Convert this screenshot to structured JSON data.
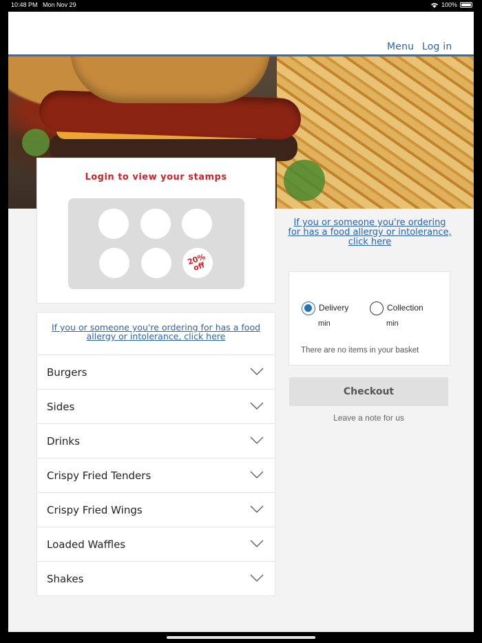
{
  "status_bar": {
    "time": "10:48 PM",
    "date": "Mon Nov 29",
    "battery": "100%"
  },
  "header": {
    "menu_link": "Menu",
    "login_link": "Log in",
    "accent_color": "#2f6fb7"
  },
  "stamps": {
    "title": "Login to view your stamps",
    "reward_line1": "20%",
    "reward_line2": "off",
    "total_stamps": 6
  },
  "allergy_notice": "If you or someone you're ordering for has a food allergy or intolerance, click here",
  "categories": [
    "Burgers",
    "Sides",
    "Drinks",
    "Crispy Fried Tenders",
    "Crispy Fried Wings",
    "Loaded Waffles",
    "Shakes"
  ],
  "order_type": {
    "delivery_label": "Delivery",
    "delivery_time": "min",
    "collection_label": "Collection",
    "collection_time": "min",
    "selected": "delivery"
  },
  "basket": {
    "empty_text": "There are no items in your basket"
  },
  "checkout_label": "Checkout",
  "note_link": "Leave a note for us"
}
